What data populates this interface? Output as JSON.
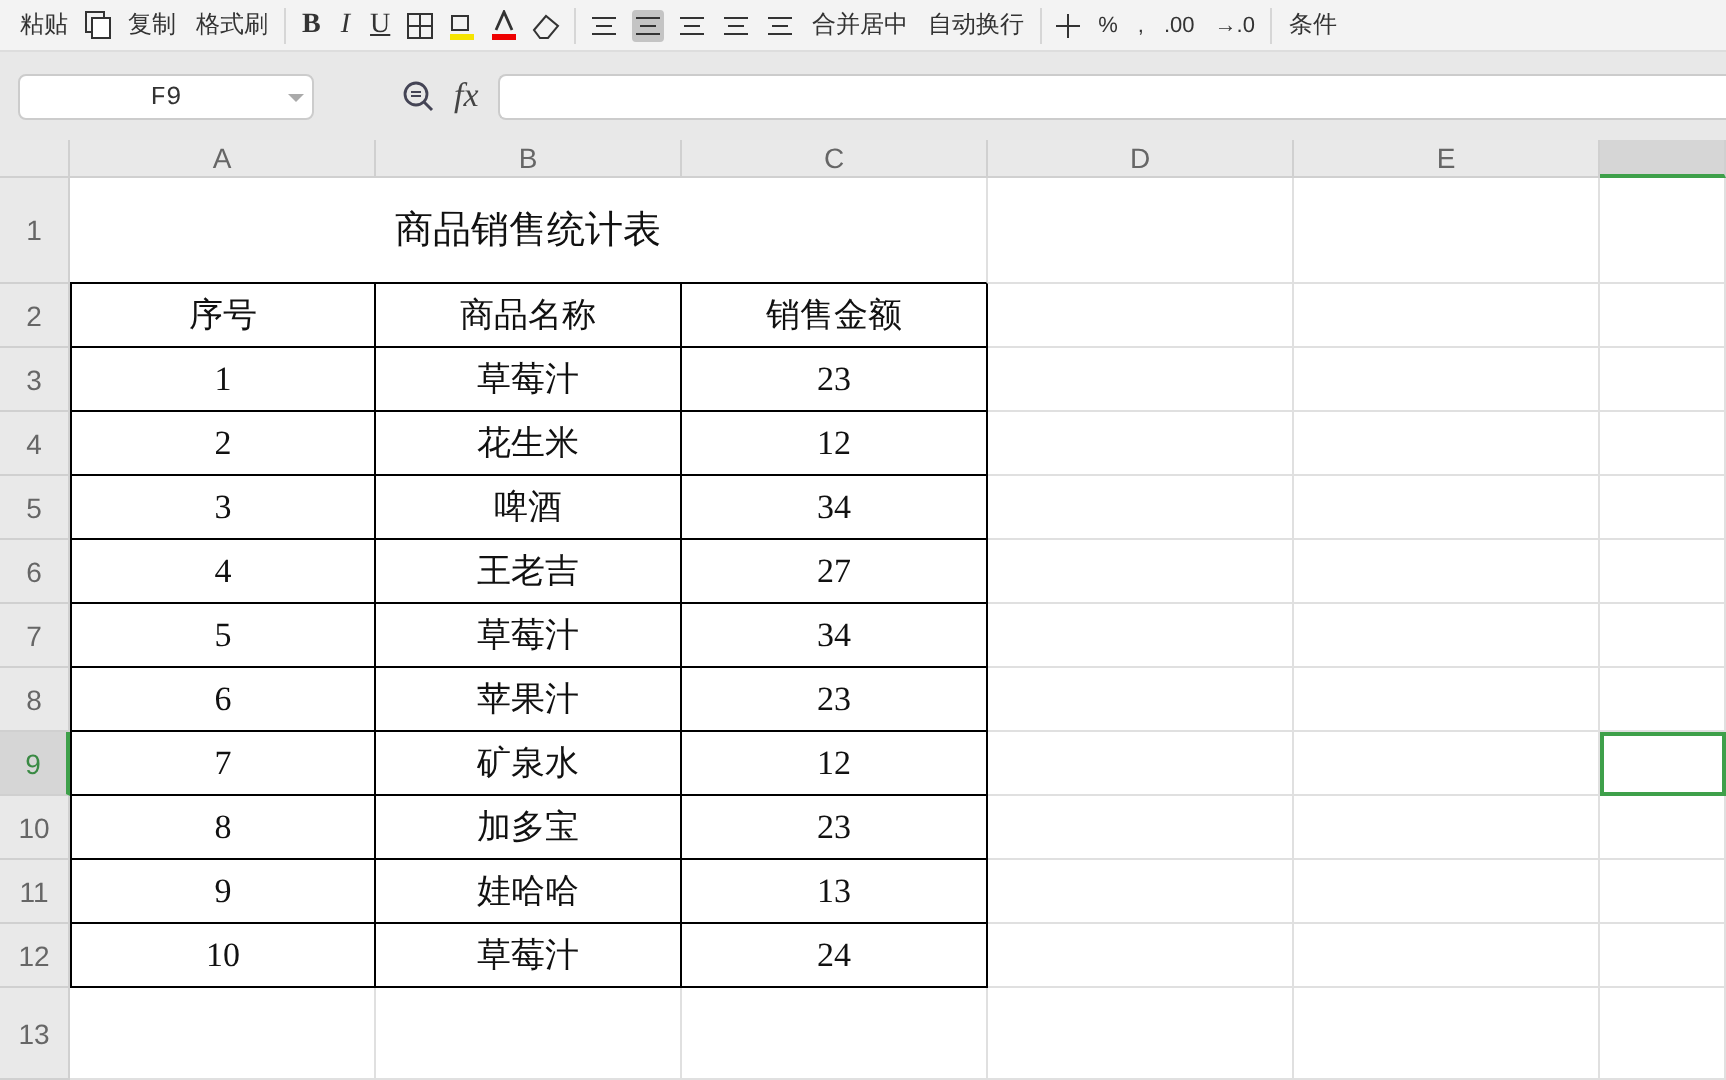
{
  "toolbar": {
    "clipboard": [
      "粘贴",
      "复制",
      "格式刷"
    ],
    "font_buttons": [
      "B",
      "I",
      "U"
    ],
    "align_buttons": [
      {
        "selected": false
      },
      {
        "selected": true
      },
      {
        "selected": false
      },
      {
        "selected": false
      },
      {
        "selected": false
      }
    ],
    "merge_labels": [
      "合并居中",
      "自动换行"
    ],
    "number_labels": [
      "%",
      ",",
      ".00",
      "→.0"
    ],
    "cut_label": "条件"
  },
  "formula_bar": {
    "name_box": "F9",
    "fx": "fx"
  },
  "columns": [
    {
      "label": "A",
      "selected": false
    },
    {
      "label": "B",
      "selected": false
    },
    {
      "label": "C",
      "selected": false
    },
    {
      "label": "D",
      "selected": false
    },
    {
      "label": "E",
      "selected": false
    },
    {
      "selected": true
    }
  ],
  "rows": [
    {
      "header": "1",
      "selected": false,
      "title": "商品销售统计表"
    },
    {
      "header": "2",
      "selected": false,
      "cells": [
        "序号",
        "商品名称",
        "销售金额"
      ]
    },
    {
      "header": "3",
      "selected": false,
      "cells": [
        "1",
        "草莓汁",
        "23"
      ]
    },
    {
      "header": "4",
      "selected": false,
      "cells": [
        "2",
        "花生米",
        "12"
      ]
    },
    {
      "header": "5",
      "selected": false,
      "cells": [
        "3",
        "啤酒",
        "34"
      ]
    },
    {
      "header": "6",
      "selected": false,
      "cells": [
        "4",
        "王老吉",
        "27"
      ]
    },
    {
      "header": "7",
      "selected": false,
      "cells": [
        "5",
        "草莓汁",
        "34"
      ]
    },
    {
      "header": "8",
      "selected": false,
      "cells": [
        "6",
        "苹果汁",
        "23"
      ]
    },
    {
      "header": "9",
      "selected": true,
      "cells": [
        "7",
        "矿泉水",
        "12"
      ]
    },
    {
      "header": "10",
      "selected": false,
      "cells": [
        "8",
        "加多宝",
        "23"
      ]
    },
    {
      "header": "11",
      "selected": false,
      "cells": [
        "9",
        "娃哈哈",
        "13"
      ]
    },
    {
      "header": "12",
      "selected": false,
      "cells": [
        "10",
        "草莓汁",
        "24"
      ]
    },
    {
      "header": "13",
      "selected": false
    }
  ]
}
